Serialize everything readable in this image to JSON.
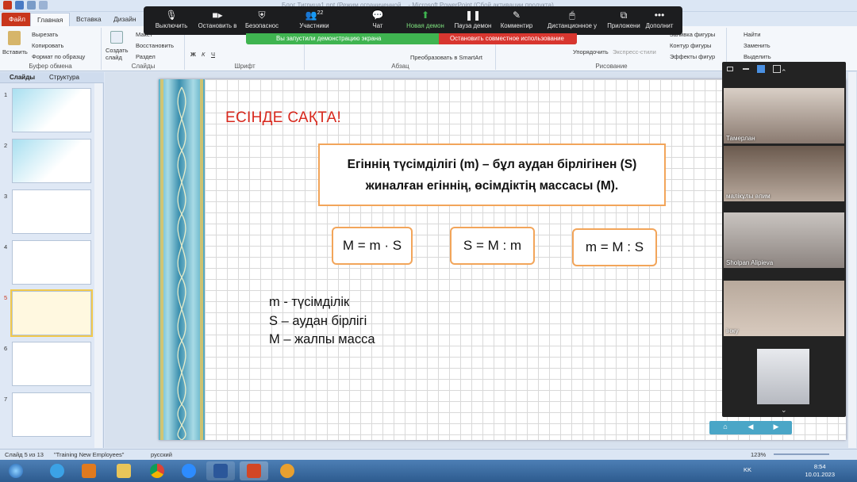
{
  "window": {
    "title": "Блог Тигрица1.ppt (Режим ограниченной... - Microsoft PowerPoint (Сбой активации продукта)"
  },
  "ribbon_tabs": [
    "Файл",
    "Главная",
    "Вставка",
    "Дизайн"
  ],
  "clipboard": {
    "paste": "Вставить",
    "cut": "Вырезать",
    "copy": "Копировать",
    "format": "Формат по образцу",
    "label": "Буфер обмена"
  },
  "slides_group": {
    "create": "Создать слайд",
    "layout": "Макет",
    "reset": "Восстановить",
    "section": "Раздел",
    "label": "Слайды"
  },
  "groups": {
    "font": "Шрифт",
    "paragraph": "Абзац",
    "drawing": "Рисование",
    "smartart": "Преобразовать в SmartArt",
    "arrange": "Упорядочить",
    "express": "Экспресс-стили",
    "fill": "Заливка фигуры",
    "outline": "Контур фигуры",
    "effects": "Эффекты фигур",
    "find": "Найти",
    "replace": "Заменить",
    "select": "Выделить"
  },
  "zoom": {
    "buttons": [
      {
        "label": "Выключить",
        "icon": "microphone-icon"
      },
      {
        "label": "Остановить в",
        "icon": "video-camera-icon"
      },
      {
        "label": "Безопаснос",
        "icon": "shield-icon"
      },
      {
        "label": "Участники",
        "icon": "participants-icon",
        "count": "22"
      },
      {
        "label": "Чат",
        "icon": "chat-icon"
      },
      {
        "label": "Новая демон",
        "icon": "share-screen-icon"
      },
      {
        "label": "Пауза демон",
        "icon": "pause-icon"
      },
      {
        "label": "Комментир",
        "icon": "pen-icon"
      },
      {
        "label": "Дистанционное у",
        "icon": "remote-control-icon"
      },
      {
        "label": "Приложени",
        "icon": "apps-icon"
      },
      {
        "label": "Дополнит",
        "icon": "more-icon"
      }
    ],
    "share_notice": "Вы запустили демонстрацию экрана",
    "stop_share": "Остановить совместное использование"
  },
  "left_pane": {
    "tabs": [
      "Слайды",
      "Структура"
    ],
    "slide_numbers": [
      "1",
      "2",
      "3",
      "4",
      "5",
      "6",
      "7"
    ],
    "selected": "5"
  },
  "slide": {
    "title": "ЕСІНДЕ САҚТА!",
    "definition_line1": "Егіннің түсімділігі (m) – бұл аудан бірлігінен (S)",
    "definition_line2": "жиналған егіннің, өсімдіктің массасы (М).",
    "formulas": [
      "M = m · S",
      "S = M : m",
      "m = M : S"
    ],
    "legend": [
      "m -  түсімділік",
      "S – аудан бірлігі",
      "М – жалпы  масса"
    ]
  },
  "video_participants": [
    "Тамерлан",
    "малікұлы әлим",
    "Sholpan Alipieva",
    "інжу",
    ""
  ],
  "status": {
    "slide": "Слайд 5 из 13",
    "theme": "\"Training New Employees\"",
    "lang": "русский",
    "zoom": "123%"
  },
  "taskbar": {
    "lang": "KK",
    "time": "8:54",
    "date": "10.01.2023"
  },
  "colors": {
    "title_red": "#d8281d",
    "box_orange": "#f2a55a",
    "zoom_green": "#3fb450",
    "stop_red": "#d8362f"
  }
}
